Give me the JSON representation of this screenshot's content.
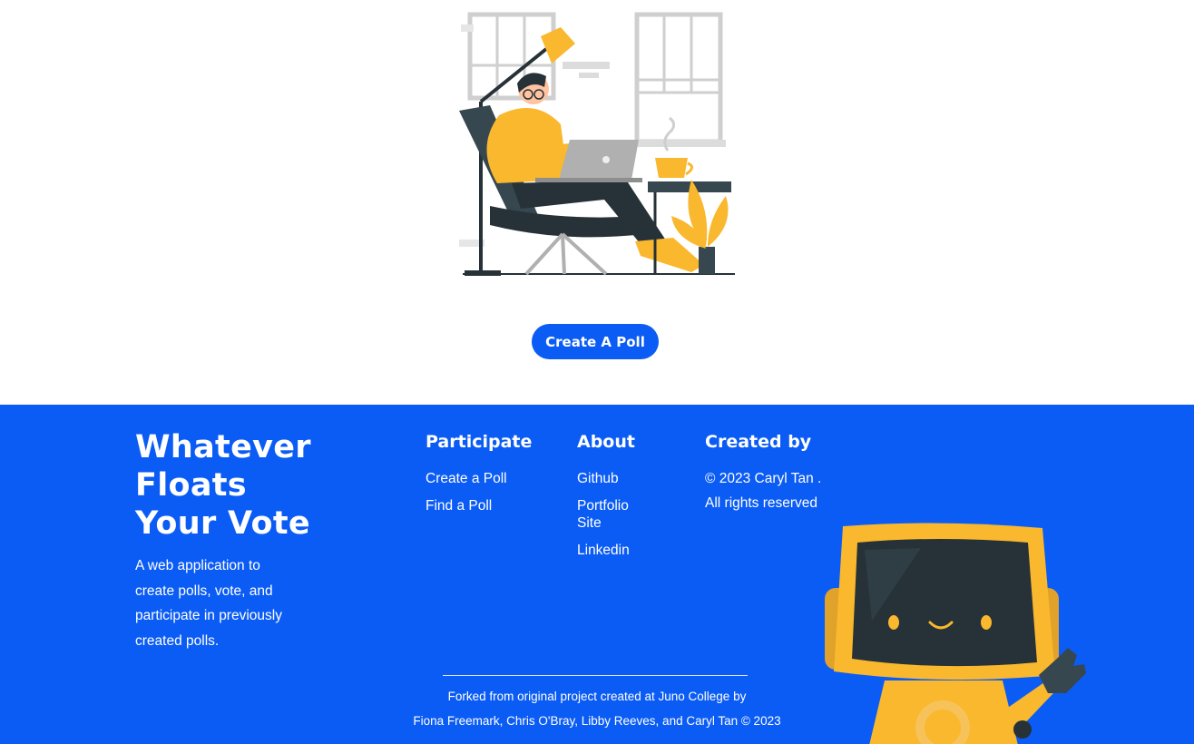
{
  "main": {
    "cta_label": "Create A Poll"
  },
  "footer": {
    "brand": [
      "Whatever",
      "Floats",
      "Your Vote"
    ],
    "tagline": "A web application to create polls, vote, and participate in previously created polls.",
    "participate": {
      "heading": "Participate",
      "links": [
        "Create a Poll",
        "Find a Poll"
      ]
    },
    "about": {
      "heading": "About",
      "links": [
        "Github",
        "Portfolio Site",
        "Linkedin"
      ]
    },
    "created": {
      "heading": "Created by",
      "text": "© 2023 Caryl Tan . All rights reserved"
    },
    "credits": {
      "line1": "Forked from original project created at Juno College by",
      "line2": "Fiona Freemark,  Chris O'Bray,  Libby Reeves, and Caryl Tan © 2023"
    }
  },
  "colors": {
    "brand_blue": "#0b5cf5",
    "accent_yellow": "#f9b82d",
    "dark_teal": "#263238"
  }
}
